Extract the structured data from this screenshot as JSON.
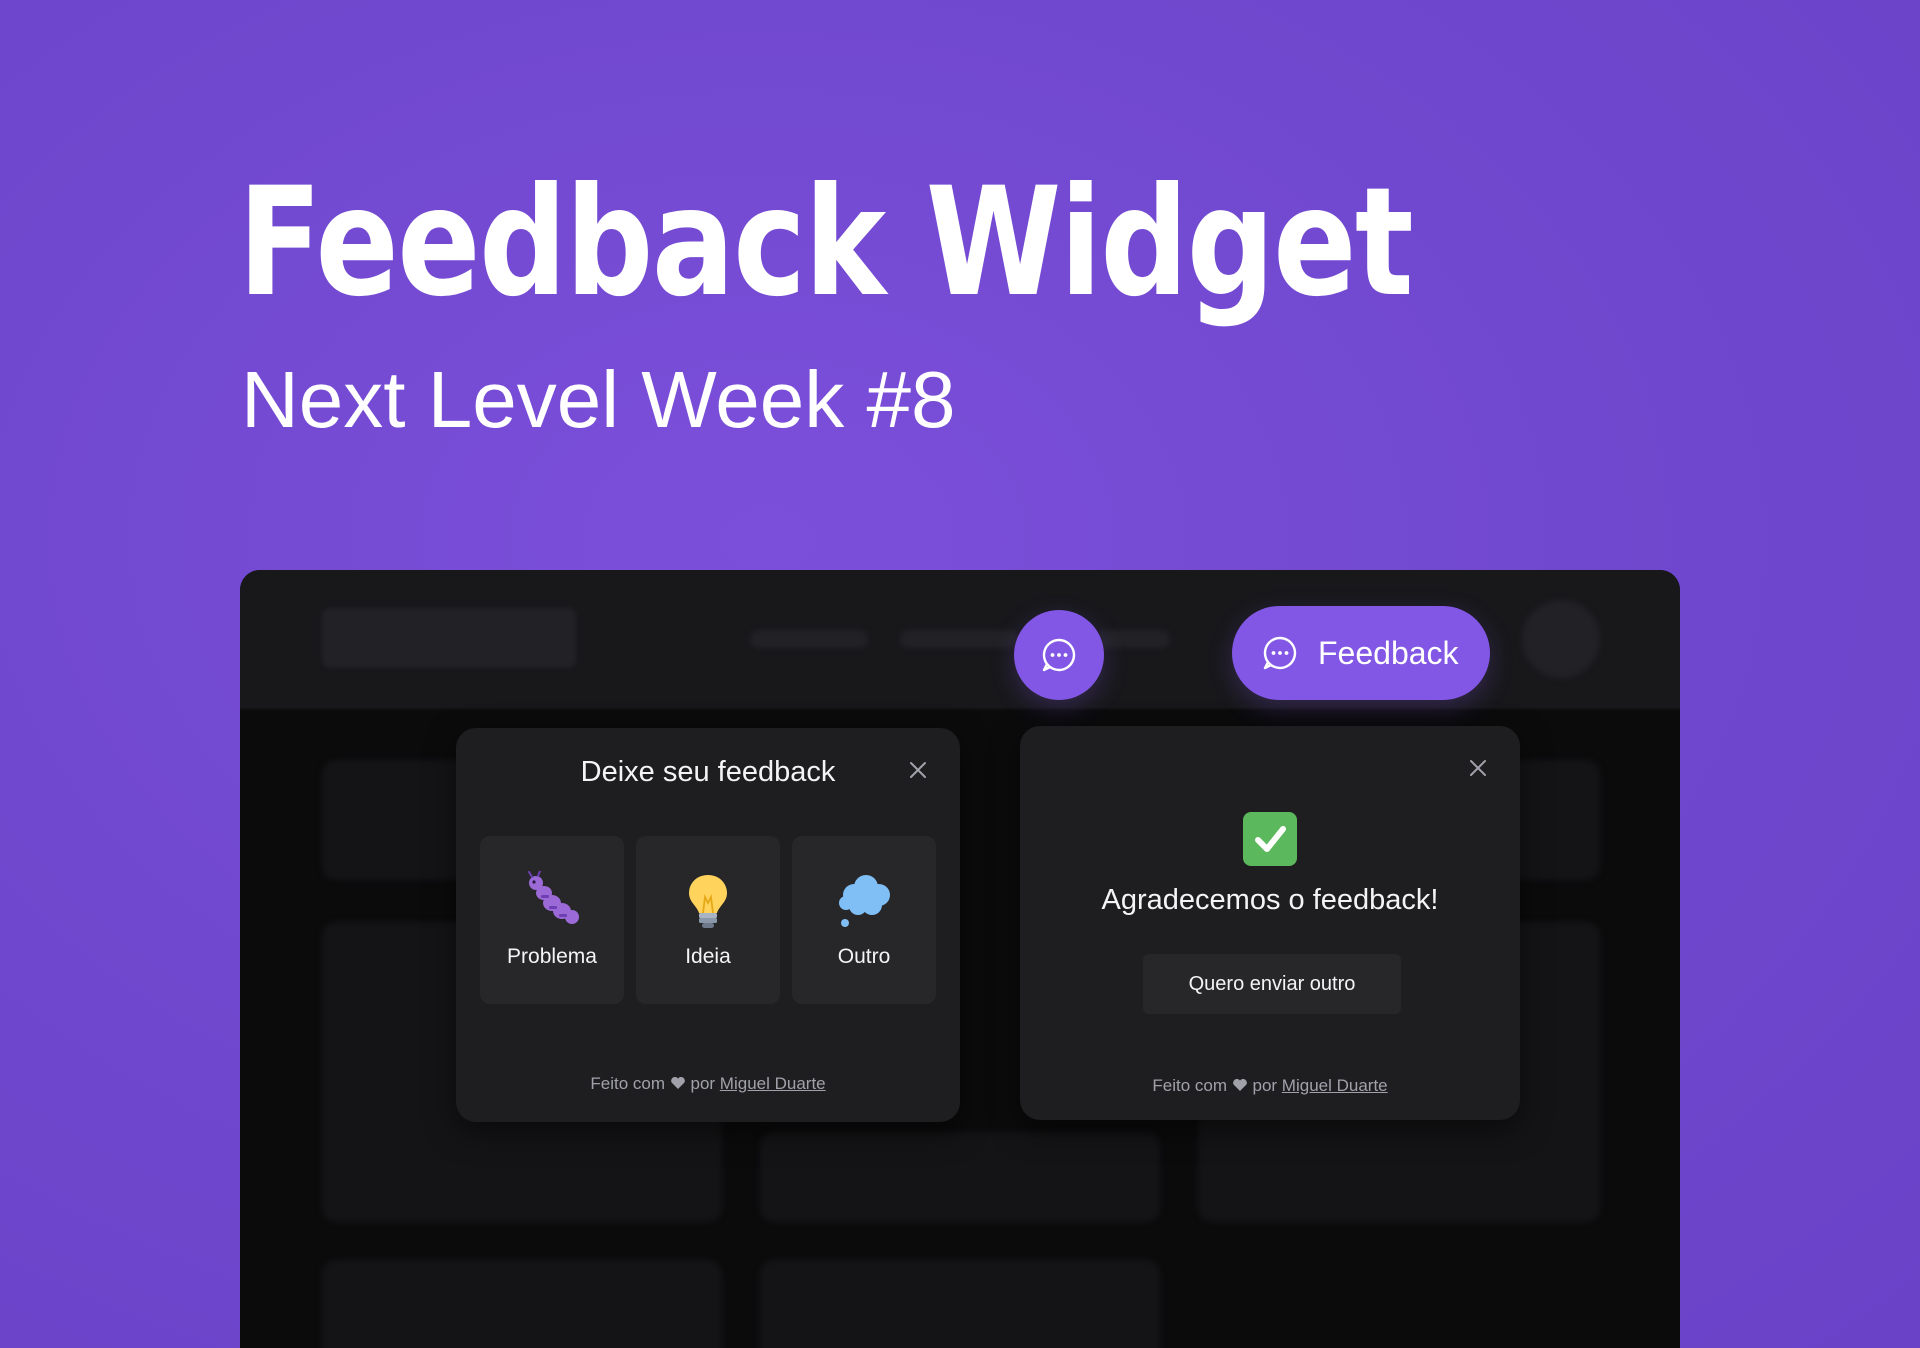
{
  "hero": {
    "title": "Feedback Widget",
    "subtitle": "Next Level Week #8"
  },
  "colors": {
    "brand": "#8257e5",
    "background": "#7048cf",
    "surface": "#1e1e21",
    "option": "#27272a"
  },
  "header": {
    "feedback_button_label": "Feedback",
    "fab_icon": "chat-dots-icon"
  },
  "widget_form": {
    "title": "Deixe seu feedback",
    "options": [
      {
        "label": "Problema",
        "icon": "bug-icon"
      },
      {
        "label": "Ideia",
        "icon": "lightbulb-icon"
      },
      {
        "label": "Outro",
        "icon": "thought-cloud-icon"
      }
    ],
    "footer_prefix": "Feito com",
    "footer_by": "por",
    "footer_author": "Miguel Duarte"
  },
  "widget_success": {
    "title": "Agradecemos o feedback!",
    "button_label": "Quero enviar outro",
    "footer_prefix": "Feito com",
    "footer_by": "por",
    "footer_author": "Miguel Duarte"
  }
}
